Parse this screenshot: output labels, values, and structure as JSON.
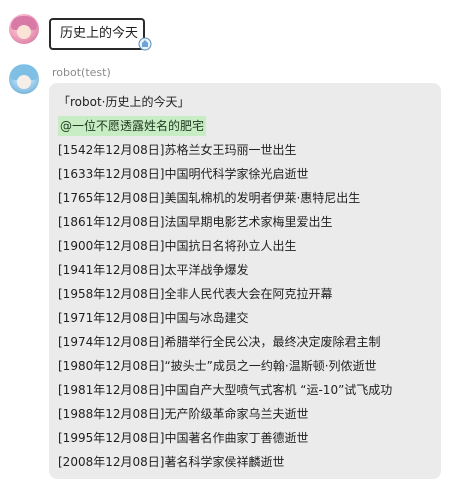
{
  "user": {
    "message": "历史上的今天"
  },
  "bot": {
    "sender": "robot(test)",
    "title": "「robot·历史上的今天」",
    "mention": "@一位不愿透露姓名的肥宅",
    "events": [
      "[1542年12月08日]苏格兰女王玛丽一世出生",
      "[1633年12月08日]中国明代科学家徐光启逝世",
      "[1765年12月08日]美国轧棉机的发明者伊莱·惠特尼出生",
      "[1861年12月08日]法国早期电影艺术家梅里爱出生",
      "[1900年12月08日]中国抗日名将孙立人出生",
      "[1941年12月08日]太平洋战争爆发",
      "[1958年12月08日]全非人民代表大会在阿克拉开幕",
      "[1971年12月08日]中国与冰岛建交",
      "[1974年12月08日]希腊举行全民公决，最终决定废除君主制",
      "[1980年12月08日]“披头士”成员之一约翰·温斯顿·列侬逝世",
      "[1981年12月08日]中国自产大型喷气式客机 “运-10”试飞成功",
      "[1988年12月08日]无产阶级革命家乌兰夫逝世",
      "[1995年12月08日]中国著名作曲家丁善德逝世",
      "[2008年12月08日]著名科学家侯祥麟逝世"
    ]
  }
}
